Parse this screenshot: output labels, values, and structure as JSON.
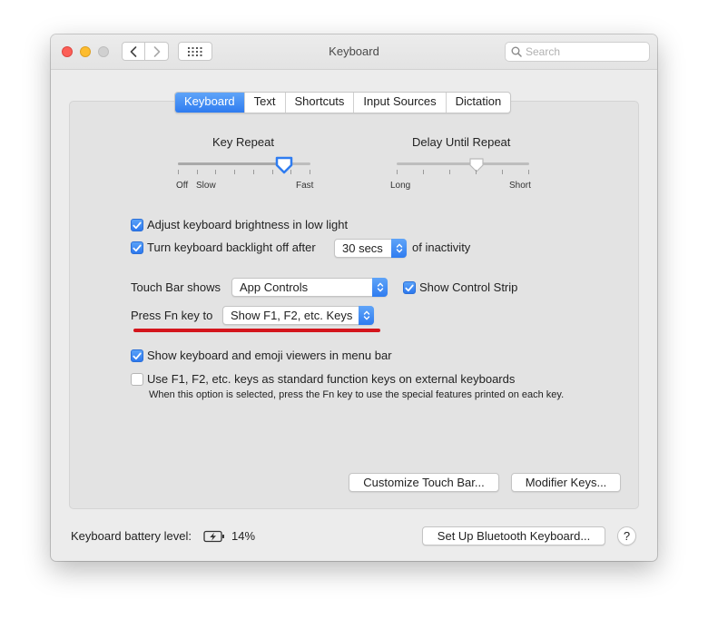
{
  "window": {
    "title": "Keyboard"
  },
  "toolbar": {
    "search_placeholder": "Search"
  },
  "tabs": [
    {
      "label": "Keyboard",
      "active": true
    },
    {
      "label": "Text",
      "active": false
    },
    {
      "label": "Shortcuts",
      "active": false
    },
    {
      "label": "Input Sources",
      "active": false
    },
    {
      "label": "Dictation",
      "active": false
    }
  ],
  "key_repeat": {
    "label": "Key Repeat",
    "min_label_1": "Off",
    "min_label_2": "Slow",
    "max_label": "Fast",
    "value_fraction": 0.8
  },
  "delay_until_repeat": {
    "label": "Delay Until Repeat",
    "min_label": "Long",
    "max_label": "Short",
    "value_fraction": 0.6
  },
  "options": {
    "brightness": {
      "label": "Adjust keyboard brightness in low light",
      "checked": true
    },
    "backlight": {
      "label": "Turn keyboard backlight off after",
      "checked": true,
      "value": "30 secs",
      "suffix": "of inactivity"
    },
    "touch_bar": {
      "label": "Touch Bar shows",
      "value": "App Controls"
    },
    "control_strip": {
      "label": "Show Control Strip",
      "checked": true
    },
    "fn_key": {
      "label": "Press Fn key to",
      "value": "Show F1, F2, etc. Keys"
    },
    "viewers": {
      "label": "Show keyboard and emoji viewers in menu bar",
      "checked": true
    },
    "function_keys": {
      "label": "Use F1, F2, etc. keys as standard function keys on external keyboards",
      "checked": false,
      "note": "When this option is selected, press the Fn key to use the special features printed on each key."
    }
  },
  "buttons": {
    "customize": "Customize Touch Bar...",
    "modifier": "Modifier Keys...",
    "bluetooth": "Set Up Bluetooth Keyboard...",
    "help": "?"
  },
  "battery": {
    "label": "Keyboard battery level:",
    "value": "14%"
  },
  "colors": {
    "accent": "#2f7cf0",
    "annotation": "#d4151c"
  }
}
